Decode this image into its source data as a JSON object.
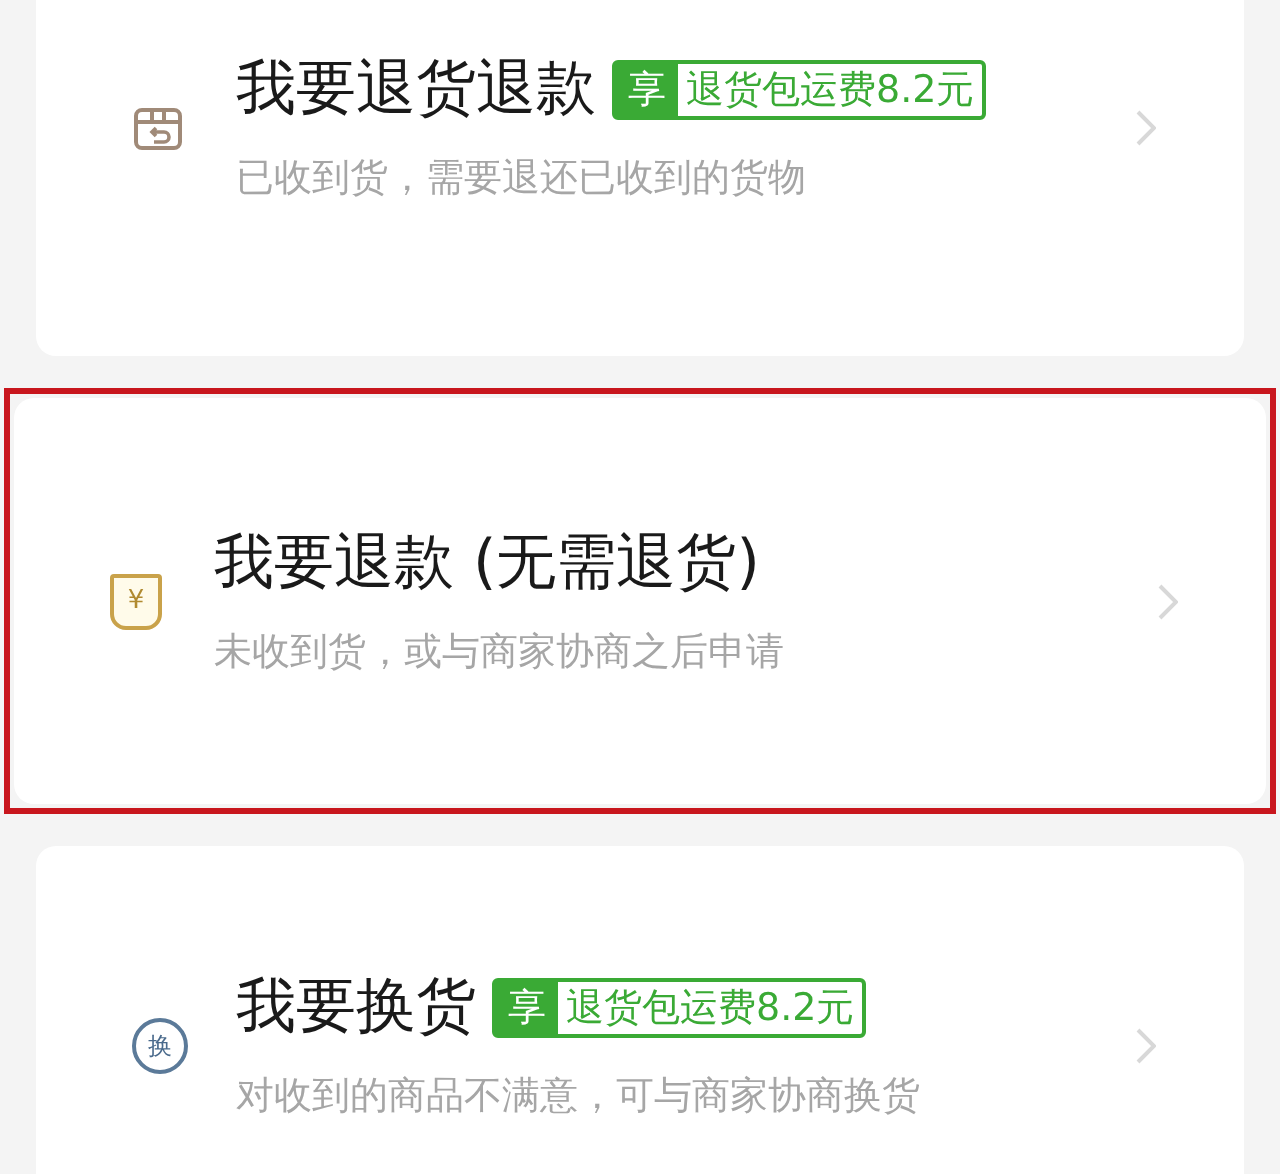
{
  "options": [
    {
      "kind": "return_refund",
      "title": "我要退货退款",
      "badge": {
        "mark": "享",
        "text": "退货包运费8.2元"
      },
      "description": "已收到货，需要退还已收到的货物",
      "highlighted": false
    },
    {
      "kind": "refund_only",
      "icon_glyph": "¥",
      "title": "我要退款 (无需退货)",
      "description": "未收到货，或与商家协商之后申请",
      "highlighted": true
    },
    {
      "kind": "exchange",
      "icon_glyph": "换",
      "title": "我要换货",
      "badge": {
        "mark": "享",
        "text": "退货包运费8.2元"
      },
      "description": "对收到的商品不满意，可与商家协商换货",
      "highlighted": false
    }
  ]
}
